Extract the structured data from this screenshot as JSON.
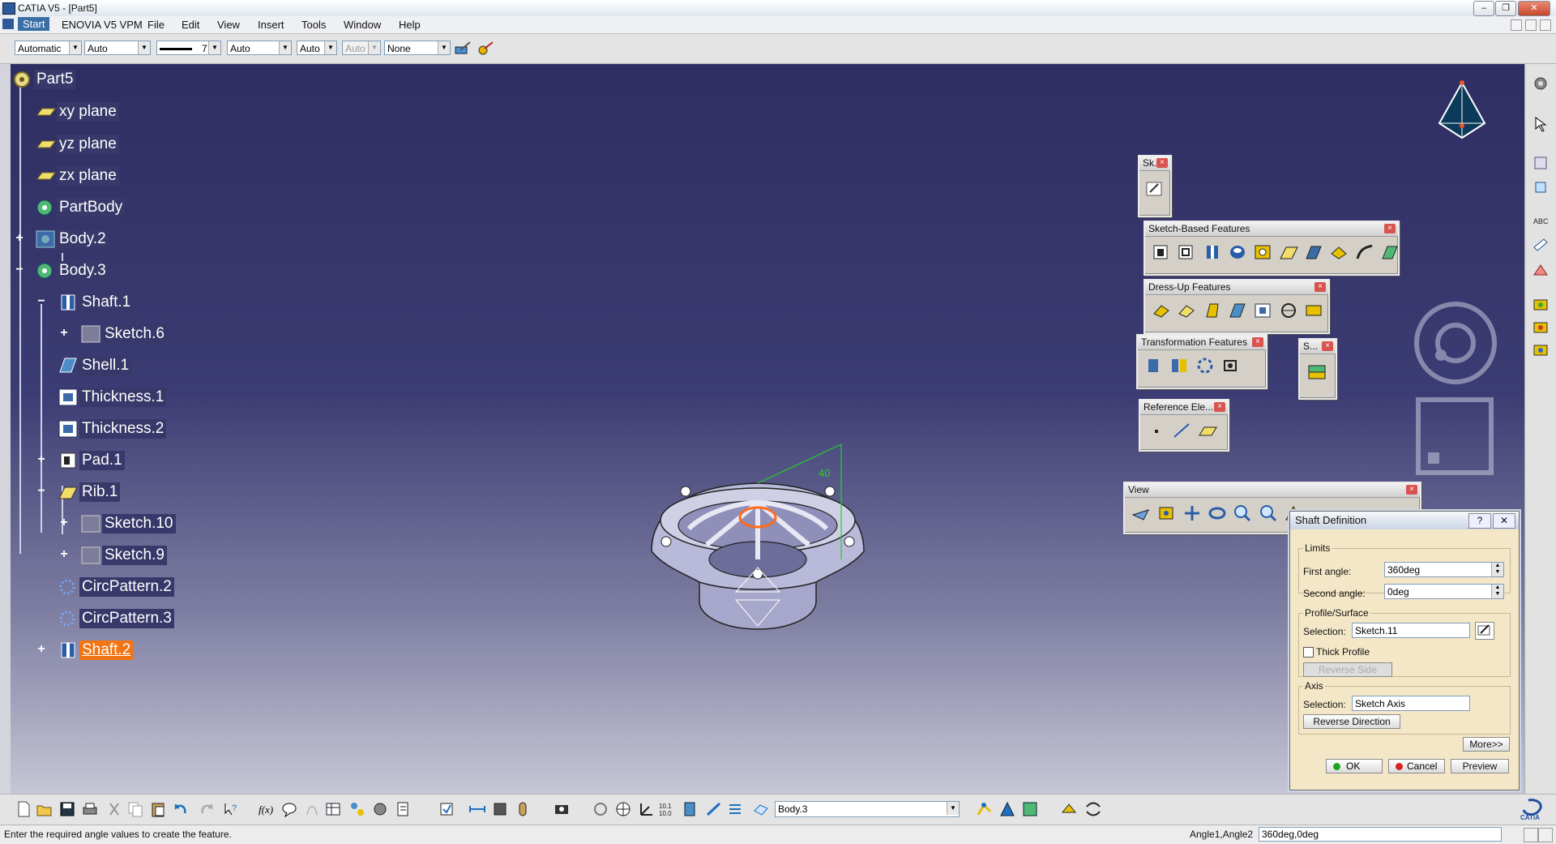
{
  "window": {
    "title": "CATIA V5 - [Part5]",
    "minimize": "–",
    "restore": "❐",
    "close": "✕"
  },
  "menu": {
    "items": [
      "Start",
      "ENOVIA V5 VPM",
      "File",
      "Edit",
      "View",
      "Insert",
      "Tools",
      "Window",
      "Help"
    ]
  },
  "properties_toolbar": {
    "color": "Automatic",
    "transparency": "Auto",
    "line_weight": "7",
    "line_type": "Auto",
    "point_type": "Auto",
    "layer_disabled": "Auto",
    "render": "None"
  },
  "tree": {
    "root": "Part5",
    "nodes": [
      {
        "label": "xy plane",
        "icon": "plane-icon"
      },
      {
        "label": "yz plane",
        "icon": "plane-icon"
      },
      {
        "label": "zx plane",
        "icon": "plane-icon"
      },
      {
        "label": "PartBody",
        "icon": "body-icon"
      },
      {
        "label": "Body.2",
        "icon": "body-icon"
      },
      {
        "label": "Body.3",
        "icon": "body-icon"
      },
      {
        "label": "Shaft.1",
        "icon": "shaft-icon"
      },
      {
        "label": "Sketch.6",
        "icon": "sketch-icon"
      },
      {
        "label": "Shell.1",
        "icon": "shell-icon"
      },
      {
        "label": "Thickness.1",
        "icon": "thickness-icon"
      },
      {
        "label": "Thickness.2",
        "icon": "thickness-icon"
      },
      {
        "label": "Pad.1",
        "icon": "pad-icon"
      },
      {
        "label": "Rib.1",
        "icon": "rib-icon"
      },
      {
        "label": "Sketch.10",
        "icon": "sketch-icon"
      },
      {
        "label": "Sketch.9",
        "icon": "sketch-icon"
      },
      {
        "label": "CircPattern.2",
        "icon": "pattern-icon"
      },
      {
        "label": "CircPattern.3",
        "icon": "pattern-icon"
      },
      {
        "label": "Shaft.2",
        "icon": "shaft-icon",
        "selected": true
      }
    ]
  },
  "toolbars": {
    "sketcher": "Sk...",
    "sketch_based": "Sketch-Based Features",
    "dress_up": "Dress-Up Features",
    "transformation": "Transformation Features",
    "surface": "S...",
    "reference": "Reference Ele...",
    "view": "View",
    "close_glyph": "×"
  },
  "dialog": {
    "title": "Shaft Definition",
    "help": "?",
    "close": "✕",
    "limits_label": "Limits",
    "first_angle_label": "First angle:",
    "first_angle": "360deg",
    "second_angle_label": "Second angle:",
    "second_angle": "0deg",
    "profile_label": "Profile/Surface",
    "profile_selection_label": "Selection:",
    "profile_selection": "Sketch.11",
    "thick_profile": "Thick Profile",
    "reverse_side": "Reverse Side",
    "axis_label": "Axis",
    "axis_selection_label": "Selection:",
    "axis_selection": "Sketch Axis",
    "reverse_direction": "Reverse Direction",
    "more": "More>>",
    "ok": "OK",
    "cancel": "Cancel",
    "preview": "Preview"
  },
  "model": {
    "dimension": "40"
  },
  "bottom_toolbar": {
    "current_body": "Body.3"
  },
  "status": {
    "message": "Enter the required angle values to create the feature.",
    "input_label": "Angle1,Angle2",
    "input_value": "360deg,0deg"
  },
  "colors": {
    "selection": "#f37412",
    "viewport_top": "#2e2e62",
    "viewport_bottom": "#c6c6d6"
  }
}
